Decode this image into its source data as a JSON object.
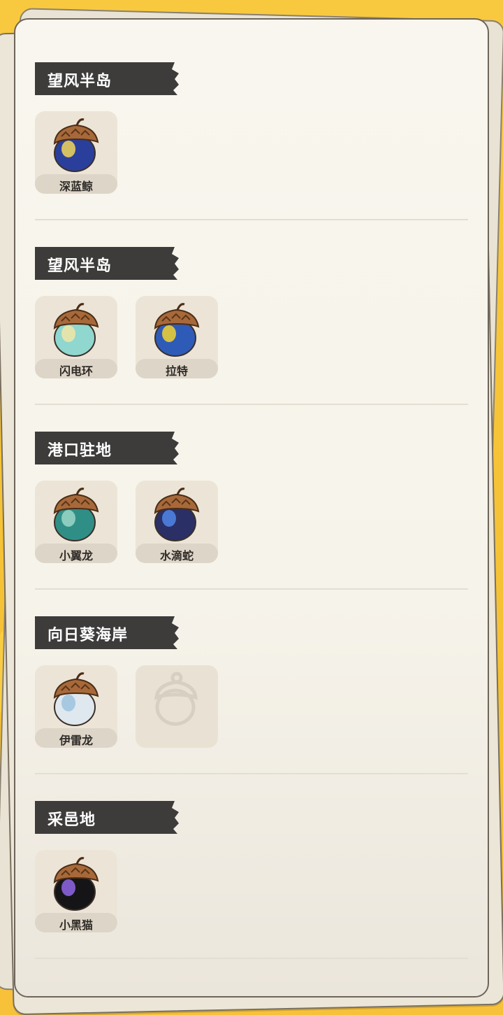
{
  "sections": [
    {
      "title": "望风半岛",
      "items": [
        {
          "name": "深蓝鲸",
          "body": "#2a3f9c",
          "accent": "#f2d75a"
        }
      ]
    },
    {
      "title": "望风半岛",
      "items": [
        {
          "name": "闪电环",
          "body": "#8fd7cf",
          "accent": "#f2e6a6"
        },
        {
          "name": "拉特",
          "body": "#2f5bb8",
          "accent": "#f2d52f"
        }
      ]
    },
    {
      "title": "港口驻地",
      "items": [
        {
          "name": "小翼龙",
          "body": "#2f8f86",
          "accent": "#9bd7c8"
        },
        {
          "name": "水滴蛇",
          "body": "#2a2f66",
          "accent": "#4f86e8"
        }
      ]
    },
    {
      "title": "向日葵海岸",
      "items": [
        {
          "name": "伊雷龙",
          "body": "#dfe7ef",
          "accent": "#9cc2de"
        },
        {
          "name": "",
          "body": "",
          "accent": "",
          "locked": true
        }
      ]
    },
    {
      "title": "采邑地",
      "items": [
        {
          "name": "小黑猫",
          "body": "#151518",
          "accent": "#8f66e6"
        }
      ]
    }
  ],
  "icons": {
    "collected": "acorn-icon",
    "locked": "acorn-outline-icon"
  },
  "colors": {
    "background": "#f7c23a",
    "paper": "#f8f6ee",
    "header": "#3d3c3b",
    "tile": "#ece5d7",
    "cap": "#a8693a"
  }
}
